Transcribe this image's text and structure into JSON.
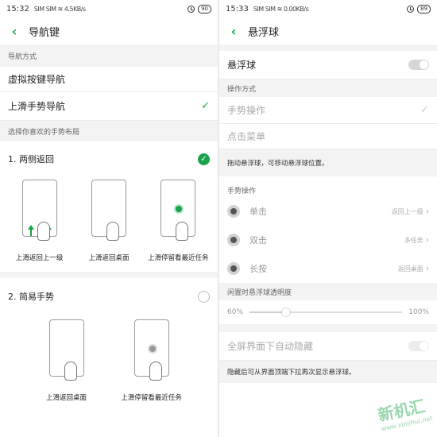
{
  "left": {
    "status": {
      "time": "15:32",
      "signal": "SIM SIM ≋ 4.5KB/s",
      "battery": "90"
    },
    "title": "导航键",
    "nav_header": "导航方式",
    "options": [
      {
        "label": "虚拟按键导航",
        "checked": false
      },
      {
        "label": "上滑手势导航",
        "checked": true
      }
    ],
    "layout_header": "选择你喜欢的手势布局",
    "layouts": [
      {
        "title": "1. 两侧返回",
        "selected": true,
        "items": [
          {
            "label": "上滑返回上一级"
          },
          {
            "label": "上滑返回桌面"
          },
          {
            "label": "上滑停留看最近任务"
          }
        ]
      },
      {
        "title": "2. 简易手势",
        "selected": false,
        "items": [
          {
            "label": "上滑返回桌面"
          },
          {
            "label": "上滑停留看最近任务"
          }
        ]
      }
    ]
  },
  "right": {
    "status": {
      "time": "15:33",
      "signal": "SIM SIM ≋ 0.00KB/s",
      "battery": "89"
    },
    "title": "悬浮球",
    "toggle_label": "悬浮球",
    "toggle_on": false,
    "method_header": "操作方式",
    "methods": [
      {
        "label": "手势操作",
        "checked": true
      },
      {
        "label": "点击菜单",
        "checked": false
      }
    ],
    "drag_note": "拖动悬浮球，可移动悬浮球位置。",
    "gesture_header": "手势操作",
    "gestures": [
      {
        "label": "单击",
        "value": "返回上一级"
      },
      {
        "label": "双击",
        "value": "多任务"
      },
      {
        "label": "长按",
        "value": "返回桌面"
      }
    ],
    "opacity_header": "闲置时悬浮球透明度",
    "opacity_min": "60%",
    "opacity_max": "100%",
    "opacity_level": 0.24,
    "fullscreen_label": "全屏界面下自动隐藏",
    "fullscreen_on": false,
    "hide_note": "隐藏后可从界面顶端下拉再次显示悬浮球。",
    "watermark": "新机汇",
    "watermark_url": "www.xinjihui.net"
  },
  "colors": {
    "accent": "#1aa34a",
    "section_bg": "#f3f3f3",
    "divider": "#e9e9e9"
  }
}
